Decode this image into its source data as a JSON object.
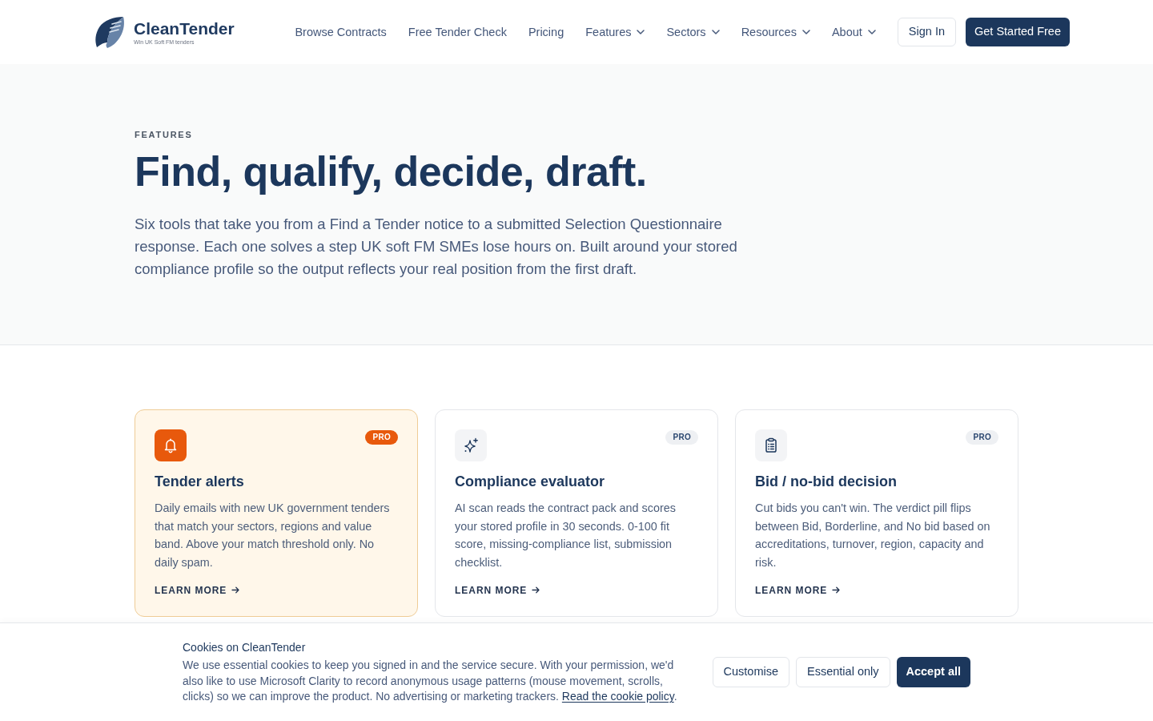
{
  "header": {
    "logo": {
      "name": "CleanTender",
      "tagline": "Win UK Soft FM tenders"
    },
    "nav": [
      {
        "label": "Browse Contracts",
        "has_menu": false
      },
      {
        "label": "Free Tender Check",
        "has_menu": false
      },
      {
        "label": "Pricing",
        "has_menu": false
      },
      {
        "label": "Features",
        "has_menu": true
      },
      {
        "label": "Sectors",
        "has_menu": true
      },
      {
        "label": "Resources",
        "has_menu": true
      },
      {
        "label": "About",
        "has_menu": true
      }
    ],
    "actions": [
      {
        "label": "Sign In",
        "kind": "secondary"
      },
      {
        "label": "Get Started Free",
        "kind": "primary"
      }
    ]
  },
  "hero": {
    "eyebrow": "FEATURES",
    "title": "Find, qualify, decide, draft.",
    "description": "Six tools that take you from a Find a Tender notice to a submitted Selection Questionnaire response. Each one solves a step UK soft FM SMEs lose hours on. Built around your stored compliance profile so the output reflects your real position from the first draft."
  },
  "features": [
    {
      "title": "Tender alerts",
      "description": "Daily emails with new UK government tenders that match your sectors, regions and value band. Above your match threshold only. No daily spam.",
      "badge": "PRO",
      "link": "LEARN MORE",
      "highlighted": true
    },
    {
      "title": "Compliance evaluator",
      "description": "AI scan reads the contract pack and scores your stored profile in 30 seconds. 0-100 fit score, missing-compliance list, submission checklist.",
      "badge": "PRO",
      "link": "LEARN MORE",
      "highlighted": false
    },
    {
      "title": "Bid / no-bid decision",
      "description": "Cut bids you can't win. The verdict pill flips between Bid, Borderline, and No bid based on accreditations, turnover, region, capacity and risk.",
      "badge": "PRO",
      "link": "LEARN MORE",
      "highlighted": false
    }
  ],
  "cookie_banner": {
    "title": "Cookies on CleanTender",
    "text": "We use essential cookies to keep you signed in and the service secure. With your permission, we'd also like to use Microsoft Clarity to record anonymous usage patterns (mouse movement, scrolls, clicks) so we can improve the product. No advertising or marketing trackers.",
    "link": "Read the cookie policy",
    "text_after_link": ".",
    "buttons": [
      {
        "label": "Customise",
        "kind": "secondary"
      },
      {
        "label": "Essential only",
        "kind": "secondary"
      },
      {
        "label": "Accept all",
        "kind": "primary"
      }
    ]
  }
}
